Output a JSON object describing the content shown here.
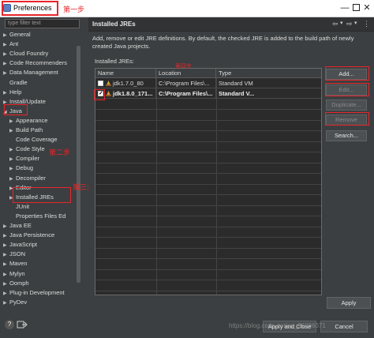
{
  "window": {
    "title": "Preferences",
    "minimize": "—",
    "close": "✕"
  },
  "annotations": {
    "step1": "第一步",
    "step2": "第二步",
    "step3": "第三步",
    "step4": "第四步"
  },
  "sidebar": {
    "filter_placeholder": "type filter text",
    "items": [
      {
        "label": "General",
        "twisty": "▶",
        "indent": 0
      },
      {
        "label": "Ant",
        "twisty": "▶",
        "indent": 0
      },
      {
        "label": "Cloud Foundry",
        "twisty": "▶",
        "indent": 0
      },
      {
        "label": "Code Recommenders",
        "twisty": "▶",
        "indent": 0
      },
      {
        "label": "Data Management",
        "twisty": "▶",
        "indent": 0
      },
      {
        "label": "Gradle",
        "twisty": "",
        "indent": 0
      },
      {
        "label": "Help",
        "twisty": "▶",
        "indent": 0
      },
      {
        "label": "Install/Update",
        "twisty": "▶",
        "indent": 0
      },
      {
        "label": "Java",
        "twisty": "◢",
        "indent": 0
      },
      {
        "label": "Appearance",
        "twisty": "▶",
        "indent": 1
      },
      {
        "label": "Build Path",
        "twisty": "▶",
        "indent": 1
      },
      {
        "label": "Code Coverage",
        "twisty": "",
        "indent": 1
      },
      {
        "label": "Code Style",
        "twisty": "▶",
        "indent": 1
      },
      {
        "label": "Compiler",
        "twisty": "▶",
        "indent": 1
      },
      {
        "label": "Debug",
        "twisty": "▶",
        "indent": 1
      },
      {
        "label": "Decompiler",
        "twisty": "▶",
        "indent": 1
      },
      {
        "label": "Editor",
        "twisty": "▶",
        "indent": 1
      },
      {
        "label": "Installed JREs",
        "twisty": "▶",
        "indent": 1
      },
      {
        "label": "JUnit",
        "twisty": "",
        "indent": 1
      },
      {
        "label": "Properties Files Ed",
        "twisty": "",
        "indent": 1
      },
      {
        "label": "Java EE",
        "twisty": "▶",
        "indent": 0
      },
      {
        "label": "Java Persistence",
        "twisty": "▶",
        "indent": 0
      },
      {
        "label": "JavaScript",
        "twisty": "▶",
        "indent": 0
      },
      {
        "label": "JSON",
        "twisty": "▶",
        "indent": 0
      },
      {
        "label": "Maven",
        "twisty": "▶",
        "indent": 0
      },
      {
        "label": "Mylyn",
        "twisty": "▶",
        "indent": 0
      },
      {
        "label": "Oomph",
        "twisty": "▶",
        "indent": 0
      },
      {
        "label": "Plug-in Development",
        "twisty": "▶",
        "indent": 0
      },
      {
        "label": "PyDev",
        "twisty": "▶",
        "indent": 0
      }
    ],
    "help_icon": "?"
  },
  "panel": {
    "title": "Installed JREs",
    "nav_back": "⇦",
    "nav_back_menu": "▾",
    "nav_fwd": "⇨",
    "nav_fwd_menu": "▾",
    "nav_more": "⋮",
    "description": "Add, remove or edit JRE definitions. By default, the checked JRE is added to the build path of newly created Java projects.",
    "installed_label": "Installed JREs:",
    "columns": [
      "Name",
      "Location",
      "Type"
    ],
    "rows": [
      {
        "checked": false,
        "name": "jdk1.7.0_80",
        "location": "C:\\Program Files\\...",
        "type": "Standard VM",
        "bold": false
      },
      {
        "checked": true,
        "name": "jdk1.8.0_171...",
        "location": "C:\\Program Files\\...",
        "type": "Standard V...",
        "bold": true
      }
    ],
    "buttons": {
      "add": "Add...",
      "edit": "Edit...",
      "duplicate": "Duplicate...",
      "remove": "Remove",
      "search": "Search..."
    },
    "apply": "Apply"
  },
  "footer": {
    "apply_close": "Apply and Close",
    "cancel": "Cancel",
    "watermark": "https://blog.csdn.net/qq_26086071"
  },
  "colors": {
    "accent_red": "#e8252a",
    "background": "#3c3f41",
    "table_bg": "#2b2b2b"
  }
}
